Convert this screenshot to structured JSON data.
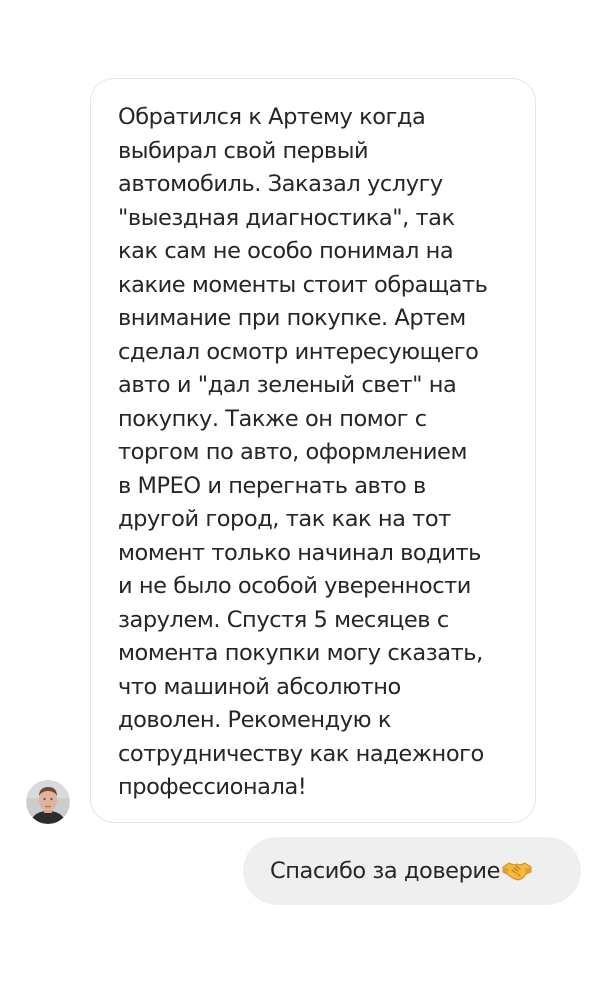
{
  "conversation": {
    "incoming": {
      "lines": [
        "Обратился к Артему когда",
        "выбирал свой первый",
        "автомобиль. Заказал услугу",
        "\"выездная диагностика\", так",
        "как сам не особо понимал на",
        "какие моменты стоит обращать",
        "внимание при покупке. Артем",
        "сделал осмотр интересующего",
        "авто и \"дал зеленый свет\" на",
        "покупку. Также он помог с",
        "торгом по авто, оформлением",
        "в МРЕО и перегнать авто в",
        "другой город, так как на тот",
        "момент только начинал водить",
        "и не было особой уверенности",
        "зарулем. Спустя 5 месяцев с",
        "момента покупки могу сказать,",
        "что машиной абсолютно",
        "доволен. Рекомендую к",
        "сотрудничеству как надежного",
        "профессионала!"
      ],
      "sender_avatar_icon": "user-avatar-icon"
    },
    "outgoing": {
      "text": "Спасибо за доверие",
      "emoji_icon": "handshake-icon"
    }
  },
  "colors": {
    "incoming_bubble_border": "#e6e6e6",
    "outgoing_bubble_bg": "#efefef",
    "text": "#262626"
  }
}
